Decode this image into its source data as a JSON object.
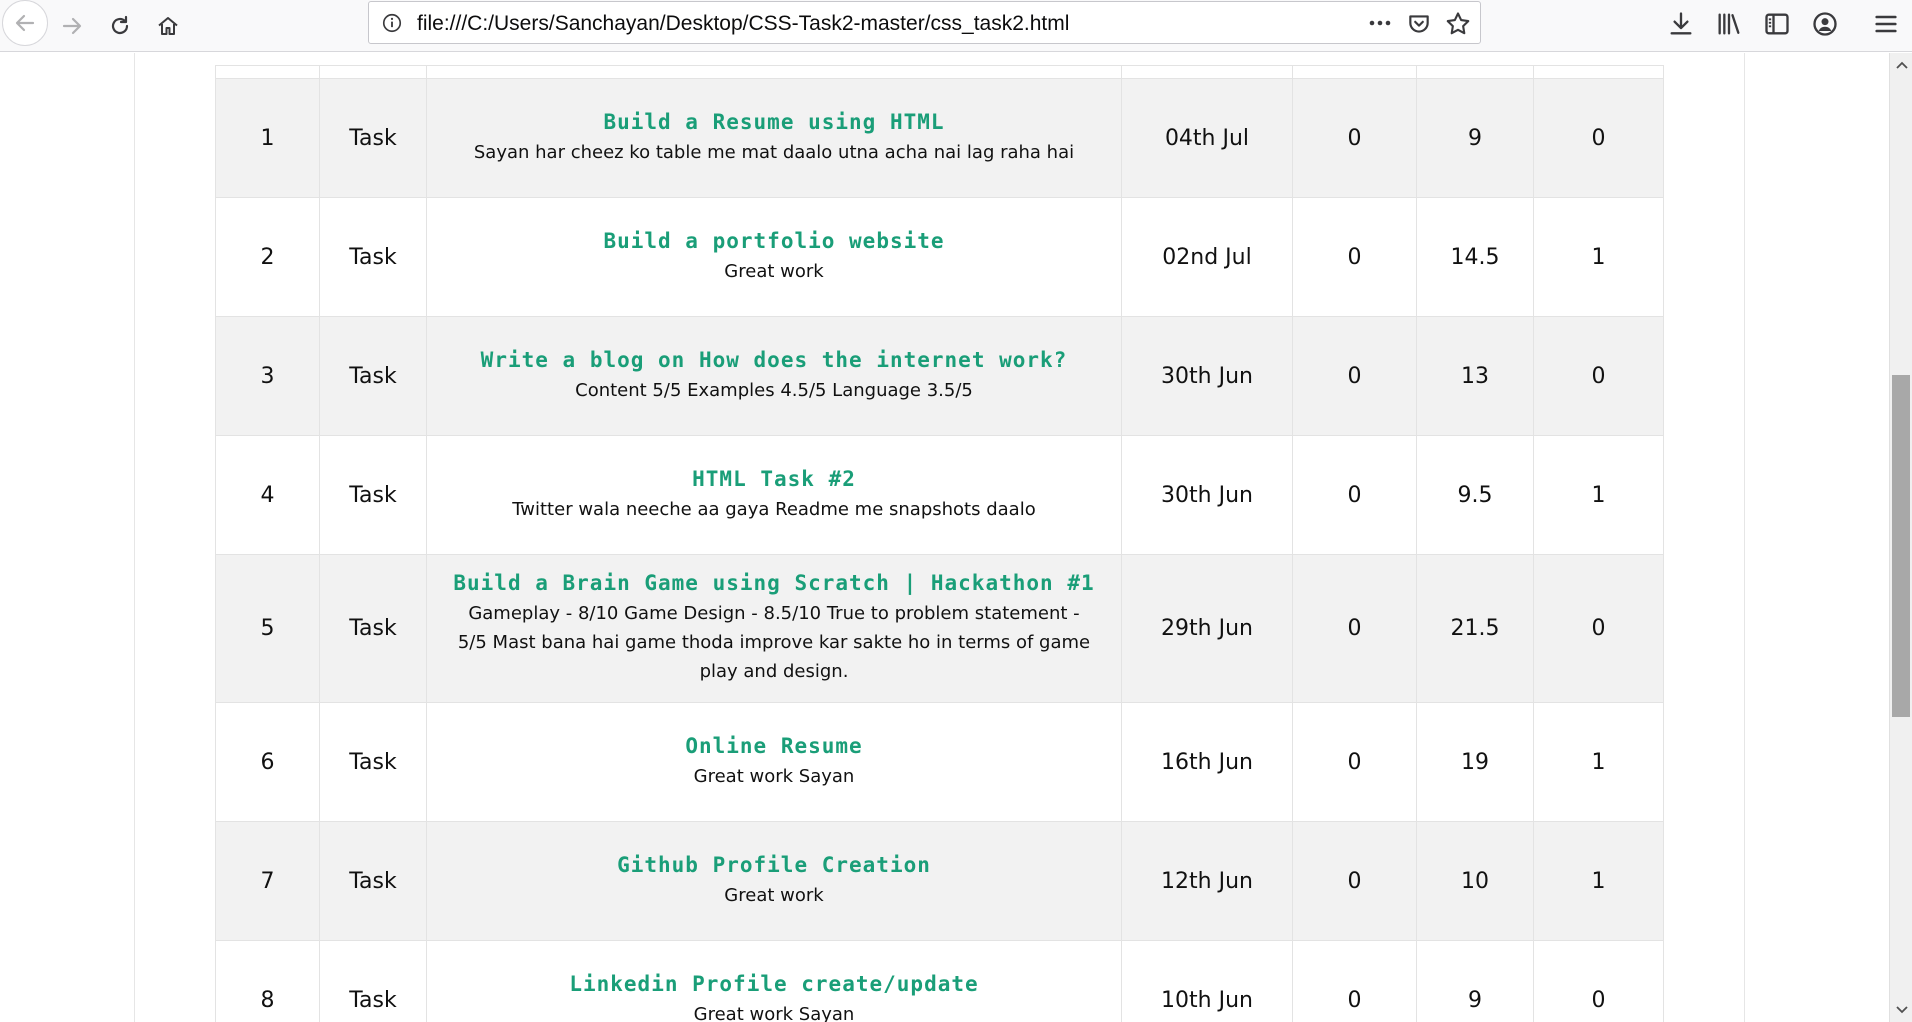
{
  "browser": {
    "url": "file:///C:/Users/Sanchayan/Desktop/CSS-Task2-master/css_task2.html"
  },
  "table": {
    "rows": [
      {
        "index": "1",
        "type": "Task",
        "title": "Build a Resume using HTML",
        "desc": "Sayan har cheez ko table me mat daalo utna acha nai lag raha hai",
        "date": "04th Jul",
        "c1": "0",
        "c2": "9",
        "c3": "0"
      },
      {
        "index": "2",
        "type": "Task",
        "title": "Build a portfolio website",
        "desc": "Great work",
        "date": "02nd Jul",
        "c1": "0",
        "c2": "14.5",
        "c3": "1"
      },
      {
        "index": "3",
        "type": "Task",
        "title": "Write a blog on How does the internet work?",
        "desc": "Content 5/5 Examples 4.5/5 Language 3.5/5",
        "date": "30th Jun",
        "c1": "0",
        "c2": "13",
        "c3": "0"
      },
      {
        "index": "4",
        "type": "Task",
        "title": "HTML Task #2",
        "desc": "Twitter wala neeche aa gaya Readme me snapshots daalo",
        "date": "30th Jun",
        "c1": "0",
        "c2": "9.5",
        "c3": "1"
      },
      {
        "index": "5",
        "type": "Task",
        "title": "Build a Brain Game using Scratch | Hackathon #1",
        "desc": "Gameplay - 8/10 Game Design - 8.5/10 True to problem statement - 5/5 Mast bana hai game thoda improve kar sakte ho in terms of game play and design.",
        "date": "29th Jun",
        "c1": "0",
        "c2": "21.5",
        "c3": "0"
      },
      {
        "index": "6",
        "type": "Task",
        "title": "Online Resume",
        "desc": "Great work Sayan",
        "date": "16th Jun",
        "c1": "0",
        "c2": "19",
        "c3": "1"
      },
      {
        "index": "7",
        "type": "Task",
        "title": "Github Profile Creation",
        "desc": "Great work",
        "date": "12th Jun",
        "c1": "0",
        "c2": "10",
        "c3": "1"
      },
      {
        "index": "8",
        "type": "Task",
        "title": "Linkedin Profile create/update",
        "desc": "Great work Sayan",
        "date": "10th Jun",
        "c1": "0",
        "c2": "9",
        "c3": "0"
      }
    ]
  },
  "colors": {
    "title": "#1a9e78",
    "stripe": "#f2f2f2"
  }
}
